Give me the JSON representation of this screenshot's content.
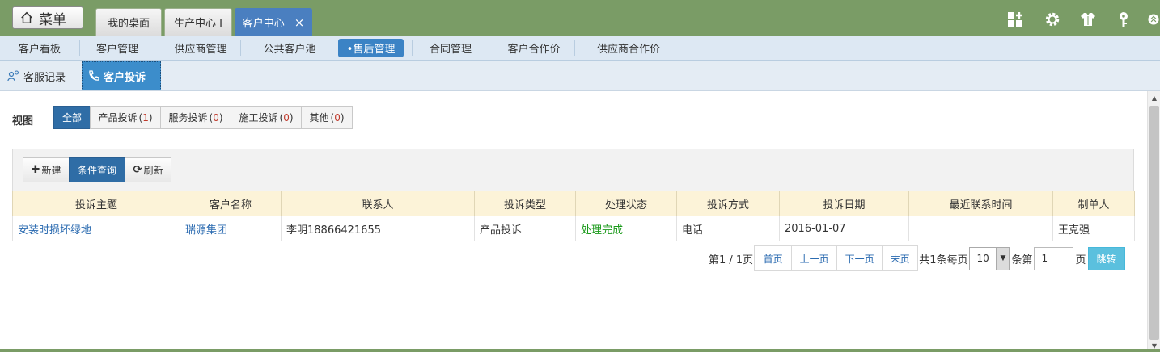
{
  "app": {
    "menu_label": "菜单",
    "tabs": [
      {
        "label": "我的桌面"
      },
      {
        "label": "生产中心 I"
      },
      {
        "label": "客户中心",
        "close": "×"
      }
    ],
    "top_icons": [
      "add-widget-icon",
      "gear-icon",
      "tshirt-icon",
      "key-icon",
      "collapse-icon"
    ]
  },
  "nav": {
    "items": [
      "客户看板",
      "客户管理",
      "供应商管理",
      "公共客户池",
      "•售后管理",
      "合同管理",
      "客户合作价",
      "供应商合作价"
    ],
    "active_index": 4
  },
  "subtabs": {
    "items": [
      {
        "label": "客服记录",
        "icon": "people-icon"
      },
      {
        "label": "客户投诉",
        "icon": "phone-icon"
      }
    ],
    "active_index": 1
  },
  "view": {
    "label": "视图",
    "filters": [
      {
        "label": "全部",
        "count": ""
      },
      {
        "label": "产品投诉",
        "count": "1"
      },
      {
        "label": "服务投诉",
        "count": "0"
      },
      {
        "label": "施工投诉",
        "count": "0"
      },
      {
        "label": "其他",
        "count": "0"
      }
    ],
    "active_index": 0
  },
  "toolbar": {
    "new_label": "新建",
    "new_icon": "plus-icon",
    "query_label": "条件查询",
    "refresh_label": "刷新",
    "refresh_icon": "refresh-icon"
  },
  "table": {
    "columns": [
      "投诉主题",
      "客户名称",
      "联系人",
      "投诉类型",
      "处理状态",
      "投诉方式",
      "投诉日期",
      "最近联系时间",
      "制单人"
    ],
    "rows": [
      [
        "安装时损坏绿地",
        "瑞源集团",
        "李明18866421655",
        "产品投诉",
        "处理完成",
        "电话",
        "2016-01-07",
        "",
        "王克强"
      ]
    ]
  },
  "pager": {
    "page_info": "第1 / 1页",
    "first": "首页",
    "prev": "上一页",
    "next": "下一页",
    "last": "末页",
    "total_text": "共1条每页",
    "page_size": "10",
    "goto_prefix": "条第",
    "page_value": "1",
    "goto_suffix": "页",
    "jump": "跳转"
  },
  "colors": {
    "topbar": "#7a9c66",
    "accent": "#3b83c5",
    "primary_button": "#2f6da6",
    "link": "#2a6ab0",
    "status_done": "#1b9a1b",
    "header_bg": "#fcf3d8"
  }
}
